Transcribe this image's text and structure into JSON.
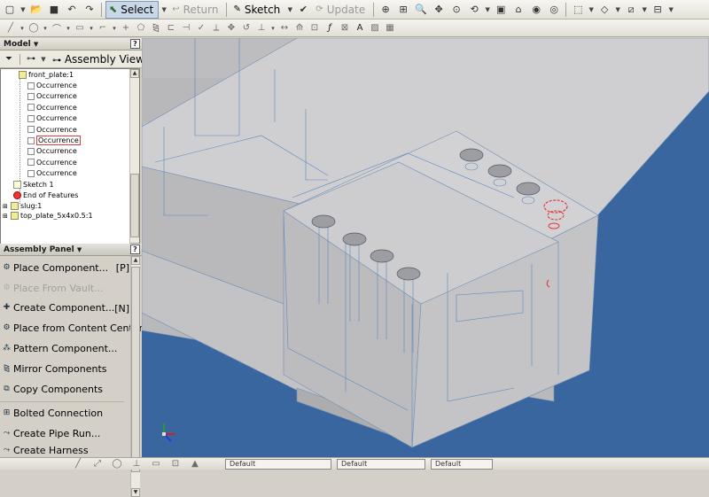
{
  "toolbar1": {
    "select_label": "Select",
    "return_label": "Return",
    "sketch_label": "Sketch",
    "update_label": "Update"
  },
  "toolbar2": {
    "icons": [
      "line-icon",
      "circle-icon",
      "arc-icon",
      "rectangle-icon",
      "fillet-icon",
      "point-icon",
      "polygon-icon",
      "mirror-icon",
      "offset-icon",
      "extend-icon",
      "trim-icon",
      "move-icon",
      "rotate-icon",
      "constraint-icon",
      "dimension-icon",
      "project-icon",
      "function-icon",
      "insert-image-icon",
      "text-icon",
      "image-icon",
      "table-icon"
    ]
  },
  "model_panel": {
    "title": "Model",
    "help_label": "?",
    "view_label": "Assembly View",
    "tree": [
      {
        "label": "front_plate:1",
        "type": "part"
      },
      {
        "label": "Occurrence",
        "type": "occurrence"
      },
      {
        "label": "Occurrence",
        "type": "occurrence"
      },
      {
        "label": "Occurrence",
        "type": "occurrence"
      },
      {
        "label": "Occurrence",
        "type": "occurrence"
      },
      {
        "label": "Occurrence",
        "type": "occurrence"
      },
      {
        "label": "Occurrence",
        "type": "occurrence",
        "highlighted": true
      },
      {
        "label": "Occurrence",
        "type": "occurrence"
      },
      {
        "label": "Occurrence",
        "type": "occurrence"
      },
      {
        "label": "Occurrence",
        "type": "occurrence"
      },
      {
        "label": "Sketch 1",
        "type": "sketch"
      },
      {
        "label": "End of Features",
        "type": "end"
      },
      {
        "label": "slug:1",
        "type": "part"
      },
      {
        "label": "top_plate_5x4x0.5:1",
        "type": "part"
      }
    ]
  },
  "assembly_panel": {
    "title": "Assembly Panel",
    "help_label": "?",
    "items": [
      {
        "label": "Place Component...",
        "shortcut": "[P]",
        "enabled": true,
        "icon": "place-component-icon"
      },
      {
        "label": "Place From Vault...",
        "shortcut": "",
        "enabled": false,
        "icon": "vault-icon"
      },
      {
        "label": "Create Component...",
        "shortcut": "[N]",
        "enabled": true,
        "icon": "create-component-icon"
      },
      {
        "label": "Place from Content Center",
        "shortcut": "",
        "enabled": true,
        "icon": "content-center-icon"
      },
      {
        "label": "Pattern Component...",
        "shortcut": "",
        "enabled": true,
        "icon": "pattern-icon"
      },
      {
        "label": "Mirror Components",
        "shortcut": "",
        "enabled": true,
        "icon": "mirror-components-icon"
      },
      {
        "label": "Copy Components",
        "shortcut": "",
        "enabled": true,
        "icon": "copy-components-icon"
      },
      {
        "label": "Bolted Connection",
        "shortcut": "",
        "enabled": true,
        "icon": "bolted-connection-icon"
      },
      {
        "label": "Create Pipe Run...",
        "shortcut": "",
        "enabled": true,
        "icon": "pipe-run-icon"
      },
      {
        "label": "Create Harness",
        "shortcut": "",
        "enabled": true,
        "icon": "harness-icon"
      }
    ]
  },
  "statusbar": {
    "style1": "Default",
    "style2": "Default",
    "style3": "Default"
  },
  "colors": {
    "viewport_bg": "#3a66a0",
    "model_gray": "#c9c9cb",
    "highlight": "#e13b3b"
  }
}
